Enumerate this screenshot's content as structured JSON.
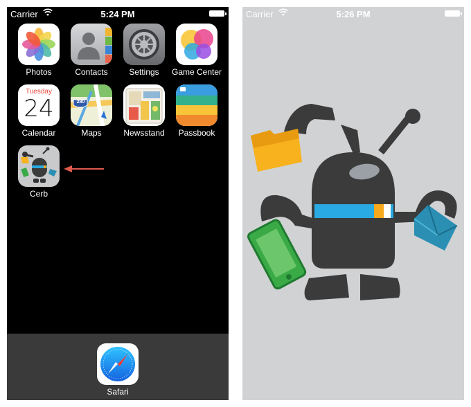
{
  "left_screen": {
    "status": {
      "carrier": "Carrier",
      "time": "5:24 PM"
    },
    "apps": [
      {
        "label": "Photos",
        "icon": "photos-icon"
      },
      {
        "label": "Contacts",
        "icon": "contacts-icon"
      },
      {
        "label": "Settings",
        "icon": "settings-gear-icon"
      },
      {
        "label": "Game Center",
        "icon": "game-center-icon"
      },
      {
        "label": "Calendar",
        "icon": "calendar-icon",
        "weekday": "Tuesday",
        "day": "24"
      },
      {
        "label": "Maps",
        "icon": "maps-icon",
        "route_number": "280"
      },
      {
        "label": "Newsstand",
        "icon": "newsstand-icon"
      },
      {
        "label": "Passbook",
        "icon": "passbook-icon"
      },
      {
        "label": "Cerb",
        "icon": "cerb-robot-icon"
      }
    ],
    "dock": {
      "label": "Safari",
      "icon": "safari-compass-icon"
    },
    "arrow_color": "#e05a4e"
  },
  "right_screen": {
    "status": {
      "carrier": "Carrier",
      "time": "5:26 PM"
    },
    "background_color": "#d1d2d4",
    "illustration": "cerb-robot-splash"
  },
  "colors": {
    "robot_body": "#3b3b3b",
    "visor_blue": "#29aae2",
    "visor_yellow": "#f7a81b",
    "folder_yellow": "#f7b21e",
    "phone_green": "#3aaa47",
    "envelope_blue": "#2b8fb3"
  }
}
